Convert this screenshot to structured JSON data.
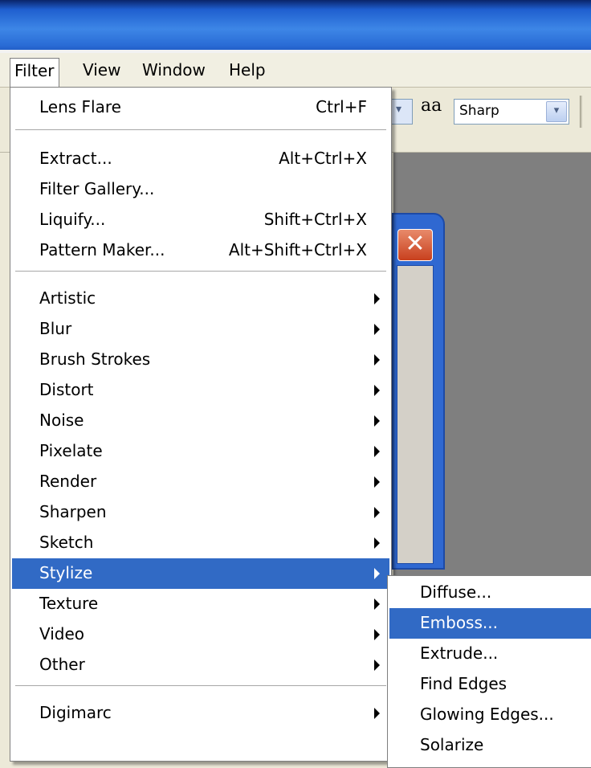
{
  "menubar": {
    "filter": "Filter",
    "view": "View",
    "window": "Window",
    "help": "Help"
  },
  "toolbar": {
    "antialias_icon": "aa",
    "antialias_value": "Sharp",
    "dropdown_glyph": "▾"
  },
  "palette": {
    "close_glyph": "✕"
  },
  "filter_menu": {
    "items": [
      {
        "label": "Lens Flare",
        "shortcut": "Ctrl+F"
      },
      {
        "label": "Extract...",
        "shortcut": "Alt+Ctrl+X"
      },
      {
        "label": "Filter Gallery...",
        "shortcut": ""
      },
      {
        "label": "Liquify...",
        "shortcut": "Shift+Ctrl+X"
      },
      {
        "label": "Pattern Maker...",
        "shortcut": "Alt+Shift+Ctrl+X"
      },
      {
        "label": "Artistic"
      },
      {
        "label": "Blur"
      },
      {
        "label": "Brush Strokes"
      },
      {
        "label": "Distort"
      },
      {
        "label": "Noise"
      },
      {
        "label": "Pixelate"
      },
      {
        "label": "Render"
      },
      {
        "label": "Sharpen"
      },
      {
        "label": "Sketch"
      },
      {
        "label": "Stylize",
        "highlighted": true
      },
      {
        "label": "Texture"
      },
      {
        "label": "Video"
      },
      {
        "label": "Other"
      },
      {
        "label": "Digimarc"
      }
    ]
  },
  "stylize_submenu": {
    "items": [
      {
        "label": "Diffuse..."
      },
      {
        "label": "Emboss...",
        "highlighted": true
      },
      {
        "label": "Extrude..."
      },
      {
        "label": "Find Edges"
      },
      {
        "label": "Glowing Edges..."
      },
      {
        "label": "Solarize"
      }
    ]
  },
  "colors": {
    "highlight": "#316ac5",
    "titlebar": "#2a6cd6",
    "workspace": "#7f7f7f"
  }
}
